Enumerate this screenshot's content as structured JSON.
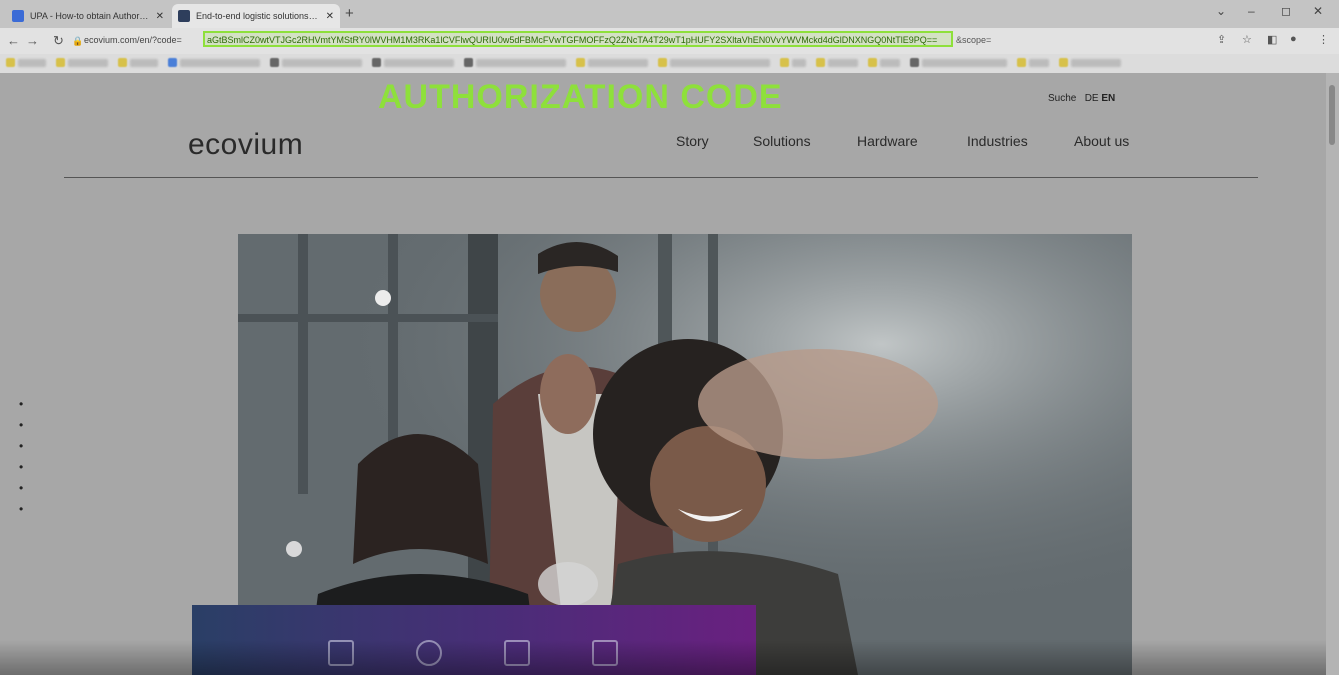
{
  "browser": {
    "tabs": [
      {
        "title": "UPA - How-to obtain Authoriza",
        "active": false
      },
      {
        "title": "End-to-end logistic solutions - E",
        "active": true
      }
    ],
    "address": {
      "prefix": "ecovium.com/en/?code=",
      "code": "aGtBSmlCZ0wtVTJGc2RHVmtYMStRY0lWVHM1M3RKa1lCVFlwQURIU0w5dFBMcFVwTGFMOFFzQ2ZNcTA4T29wT1pHUFY2SXltaVhEN0VvYWVMckd4dGlDNXNGQ0NtTlE9PQ==",
      "suffix": "&scope="
    }
  },
  "overlay": {
    "title": "AUTHORIZATION CODE",
    "color": "#8ee03b"
  },
  "site": {
    "lang_search": "Suche",
    "lang_de": "DE",
    "lang_en": "EN",
    "logo": "ecovium",
    "menu": [
      "Story",
      "Solutions",
      "Hardware",
      "Industries",
      "About us"
    ]
  }
}
